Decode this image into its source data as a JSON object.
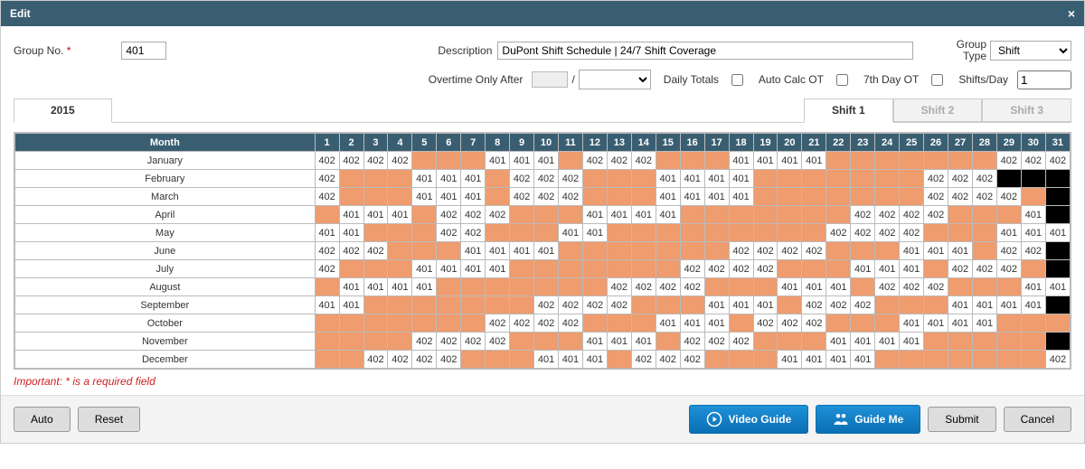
{
  "window": {
    "title": "Edit"
  },
  "fields": {
    "group_no_label": "Group No.",
    "group_no_value": "401",
    "description_label": "Description",
    "description_value": "DuPont Shift Schedule | 24/7 Shift Coverage",
    "group_type_label_line1": "Group",
    "group_type_label_line2": "Type",
    "group_type_value": "Shift",
    "overtime_label": "Overtime Only After",
    "overtime_value": "",
    "overtime_divider": "/",
    "daily_totals_label": "Daily Totals",
    "auto_calc_label": "Auto Calc OT",
    "seventh_day_label": "7th Day OT",
    "shifts_day_label": "Shifts/Day",
    "shifts_day_value": "1"
  },
  "tabs": {
    "year": "2015",
    "shifts": [
      "Shift 1",
      "Shift 2",
      "Shift 3"
    ],
    "active_shift": 0
  },
  "grid": {
    "month_header": "Month",
    "days": [
      "1",
      "2",
      "3",
      "4",
      "5",
      "6",
      "7",
      "8",
      "9",
      "10",
      "11",
      "12",
      "13",
      "14",
      "15",
      "16",
      "17",
      "18",
      "19",
      "20",
      "21",
      "22",
      "23",
      "24",
      "25",
      "26",
      "27",
      "28",
      "29",
      "30",
      "31"
    ],
    "rows": [
      {
        "month": "January",
        "cells": [
          "402",
          "402",
          "402",
          "402",
          "",
          "",
          "",
          "401",
          "401",
          "401",
          "",
          "402",
          "402",
          "402",
          "",
          "",
          "",
          "401",
          "401",
          "401",
          "401",
          "",
          "",
          "",
          "",
          "",
          "",
          "",
          "402",
          "402",
          "402"
        ]
      },
      {
        "month": "February",
        "cells": [
          "402",
          "",
          "",
          "",
          "401",
          "401",
          "401",
          "",
          "402",
          "402",
          "402",
          "",
          "",
          "",
          "401",
          "401",
          "401",
          "401",
          "",
          "",
          "",
          "",
          "",
          "",
          "",
          "402",
          "402",
          "402",
          "B",
          "B",
          "B"
        ]
      },
      {
        "month": "March",
        "cells": [
          "402",
          "",
          "",
          "",
          "401",
          "401",
          "401",
          "",
          "402",
          "402",
          "402",
          "",
          "",
          "",
          "401",
          "401",
          "401",
          "401",
          "",
          "",
          "",
          "",
          "",
          "",
          "",
          "402",
          "402",
          "402",
          "402",
          "",
          "B"
        ]
      },
      {
        "month": "April",
        "cells": [
          "",
          "401",
          "401",
          "401",
          "",
          "402",
          "402",
          "402",
          "",
          "",
          "",
          "401",
          "401",
          "401",
          "401",
          "",
          "",
          "",
          "",
          "",
          "",
          "",
          "402",
          "402",
          "402",
          "402",
          "",
          "",
          "",
          "401",
          "B"
        ]
      },
      {
        "month": "May",
        "cells": [
          "401",
          "401",
          "",
          "",
          "",
          "402",
          "402",
          "",
          "",
          "",
          "401",
          "401",
          "",
          "",
          "",
          "",
          "",
          "",
          "",
          "",
          "",
          "402",
          "402",
          "402",
          "402",
          "",
          "",
          "",
          "401",
          "401",
          "401"
        ]
      },
      {
        "month": "June",
        "cells": [
          "402",
          "402",
          "402",
          "",
          "",
          "",
          "401",
          "401",
          "401",
          "401",
          "",
          "",
          "",
          "",
          "",
          "",
          "",
          "402",
          "402",
          "402",
          "402",
          "",
          "",
          "",
          "401",
          "401",
          "401",
          "",
          "402",
          "402",
          "B"
        ]
      },
      {
        "month": "July",
        "cells": [
          "402",
          "",
          "",
          "",
          "401",
          "401",
          "401",
          "401",
          "",
          "",
          "",
          "",
          "",
          "",
          "",
          "402",
          "402",
          "402",
          "402",
          "",
          "",
          "",
          "401",
          "401",
          "401",
          "",
          "402",
          "402",
          "402",
          "",
          "B"
        ]
      },
      {
        "month": "August",
        "cells": [
          "",
          "401",
          "401",
          "401",
          "401",
          "",
          "",
          "",
          "",
          "",
          "",
          "",
          "402",
          "402",
          "402",
          "402",
          "",
          "",
          "",
          "401",
          "401",
          "401",
          "",
          "402",
          "402",
          "402",
          "",
          "",
          "",
          "401",
          "401"
        ]
      },
      {
        "month": "September",
        "cells": [
          "401",
          "401",
          "",
          "",
          "",
          "",
          "",
          "",
          "",
          "402",
          "402",
          "402",
          "402",
          "",
          "",
          "",
          "401",
          "401",
          "401",
          "",
          "402",
          "402",
          "402",
          "",
          "",
          "",
          "401",
          "401",
          "401",
          "401",
          "B"
        ]
      },
      {
        "month": "October",
        "cells": [
          "",
          "",
          "",
          "",
          "",
          "",
          "",
          "402",
          "402",
          "402",
          "402",
          "",
          "",
          "",
          "401",
          "401",
          "401",
          "",
          "402",
          "402",
          "402",
          "",
          "",
          "",
          "401",
          "401",
          "401",
          "401",
          "",
          "",
          ""
        ]
      },
      {
        "month": "November",
        "cells": [
          "",
          "",
          "",
          "",
          "402",
          "402",
          "402",
          "402",
          "",
          "",
          "",
          "401",
          "401",
          "401",
          "",
          "402",
          "402",
          "402",
          "",
          "",
          "",
          "401",
          "401",
          "401",
          "401",
          "",
          "",
          "",
          "",
          "",
          "B"
        ]
      },
      {
        "month": "December",
        "cells": [
          "",
          "",
          "402",
          "402",
          "402",
          "402",
          "",
          "",
          "",
          "401",
          "401",
          "401",
          "",
          "402",
          "402",
          "402",
          "",
          "",
          "",
          "401",
          "401",
          "401",
          "401",
          "",
          "",
          "",
          "",
          "",
          "",
          "",
          "402"
        ]
      }
    ]
  },
  "footer": {
    "important": "Important: * is a required field",
    "auto": "Auto",
    "reset": "Reset",
    "video_guide": "Video Guide",
    "guide_me": "Guide Me",
    "submit": "Submit",
    "cancel": "Cancel"
  }
}
